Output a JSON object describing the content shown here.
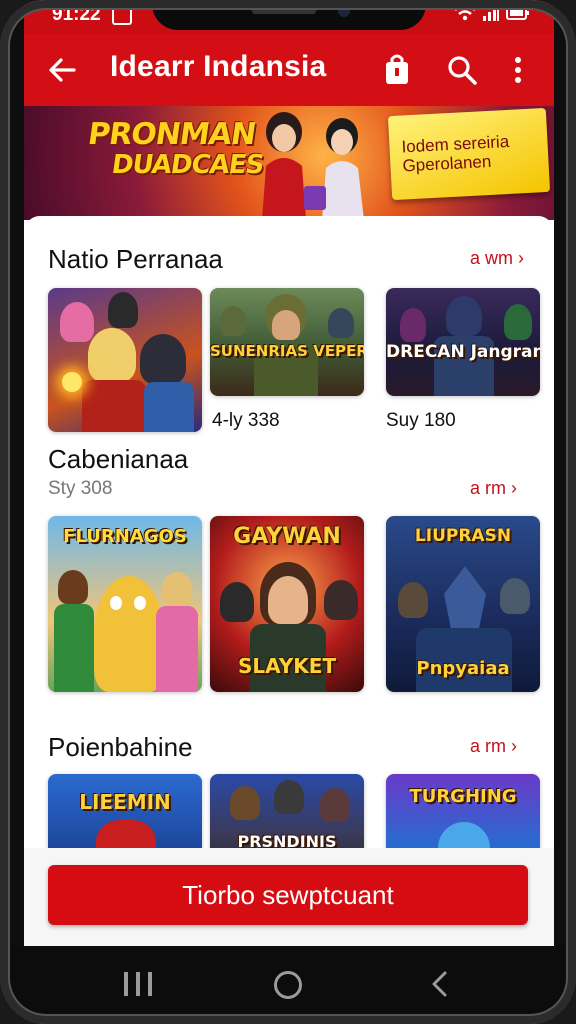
{
  "status": {
    "time": "91:22"
  },
  "appbar": {
    "title": "Idearr Indansia"
  },
  "banner": {
    "headline_1": "PRONMAN",
    "headline_2": "DUADCAES",
    "card_text": "Iodem sereiria Gperolanen"
  },
  "sections": [
    {
      "title": "Natio Perranaa",
      "see_all": "a wm",
      "tiles": [
        {
          "art": "",
          "caption": ""
        },
        {
          "art": "SUNENRIAS VEPER",
          "caption": "4-ly 338"
        },
        {
          "art": "DRECAN Jangrans",
          "caption": "Suy 180"
        }
      ]
    },
    {
      "title": "Cabenianaa",
      "subtitle": "Sty 308",
      "see_all": "a rm",
      "tiles": [
        {
          "art": "FLURNAGOS"
        },
        {
          "art": "GAYWAN",
          "art_2": "SLAYKET"
        },
        {
          "art": "LIUPRASN",
          "art_2": "Pnpyaiaa"
        }
      ]
    },
    {
      "title": "Poienbahine",
      "see_all": "a rm",
      "tiles": [
        {
          "art": "LIEEMIN"
        },
        {
          "art": "PRSNDINIS"
        },
        {
          "art": "TURGHING"
        }
      ]
    }
  ],
  "cta": {
    "label": "Tiorbo sewptcuant"
  },
  "colors": {
    "brand_red": "#d30f15",
    "link_red": "#c4121a"
  },
  "icons": [
    "back-arrow-icon",
    "shopping-bag-icon",
    "search-icon",
    "more-vert-icon",
    "chevron-right-icon",
    "wifi-icon",
    "signal-icon",
    "battery-icon",
    "nav-recents-icon",
    "nav-home-icon",
    "nav-back-icon"
  ]
}
